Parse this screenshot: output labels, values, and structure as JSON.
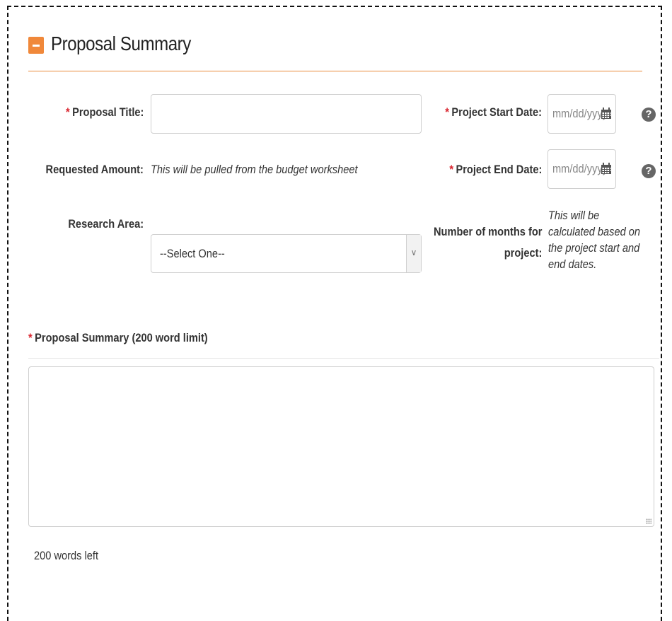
{
  "section": {
    "title": "Proposal Summary",
    "collapse_icon": "minus-square-icon",
    "accent_color": "#f0883a"
  },
  "fields": {
    "proposal_title": {
      "required_mark": "*",
      "label": "Proposal Title:",
      "value": ""
    },
    "requested_amount": {
      "label": "Requested Amount:",
      "note": "This will be pulled from the budget worksheet"
    },
    "research_area": {
      "label": "Research Area:",
      "selected": "--Select One--"
    },
    "project_start_date": {
      "required_mark": "*",
      "label": "Project Start Date:",
      "placeholder": "mm/dd/yyyy",
      "icon": "calendar-icon",
      "help_icon": "question-circle-icon"
    },
    "project_end_date": {
      "required_mark": "*",
      "label": "Project End Date:",
      "placeholder": "mm/dd/yyyy",
      "icon": "calendar-icon",
      "help_icon": "question-circle-icon"
    },
    "months": {
      "label_line1": "Number of months for",
      "label_line2": "project:",
      "note": "This will be calculated based on the project start and end dates."
    }
  },
  "summary": {
    "required_mark": "*",
    "label": "Proposal Summary (200 word limit)",
    "value": "",
    "words_left": "200 words left"
  }
}
